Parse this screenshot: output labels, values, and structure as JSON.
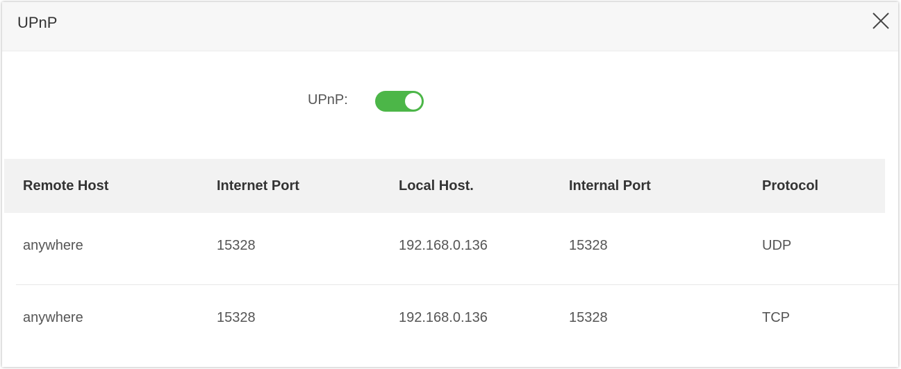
{
  "dialog": {
    "title": "UPnP",
    "close_icon": "close-icon"
  },
  "upnp": {
    "label": "UPnP:",
    "enabled": true,
    "toggle_color": "#4cb648"
  },
  "table": {
    "columns": [
      "Remote Host",
      "Internet Port",
      "Local Host.",
      "Internal Port",
      "Protocol"
    ],
    "rows": [
      [
        "anywhere",
        "15328",
        "192.168.0.136",
        "15328",
        "UDP"
      ],
      [
        "anywhere",
        "15328",
        "192.168.0.136",
        "15328",
        "TCP"
      ]
    ]
  }
}
